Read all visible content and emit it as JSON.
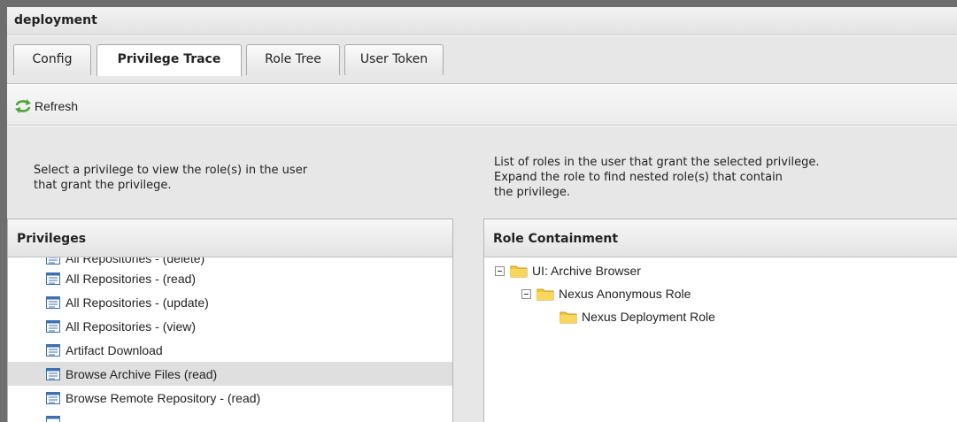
{
  "window": {
    "title": "deployment"
  },
  "tabs": [
    {
      "label": "Config"
    },
    {
      "label": "Privilege Trace"
    },
    {
      "label": "Role Tree"
    },
    {
      "label": "User Token"
    }
  ],
  "toolbar": {
    "refresh_label": "Refresh"
  },
  "descriptions": {
    "left_line1": "Select a privilege to view the role(s) in the user",
    "left_line2": "that grant the privilege.",
    "right_line1": "List of roles in the user that grant the selected privilege.",
    "right_line2": "Expand the role to find nested role(s) that contain",
    "right_line3": "the privilege."
  },
  "privileges": {
    "header": "Privileges",
    "items": [
      {
        "label": "All Repositories - (delete)"
      },
      {
        "label": "All Repositories - (read)"
      },
      {
        "label": "All Repositories - (update)"
      },
      {
        "label": "All Repositories - (view)"
      },
      {
        "label": "Artifact Download"
      },
      {
        "label": "Browse Archive Files (read)"
      },
      {
        "label": "Browse Remote Repository - (read)"
      }
    ],
    "selected": "Browse Archive Files (read)"
  },
  "role_containment": {
    "header": "Role Containment",
    "nodes": [
      {
        "label": "UI: Archive Browser"
      },
      {
        "label": "Nexus Anonymous Role"
      },
      {
        "label": "Nexus Deployment Role"
      }
    ]
  },
  "colors": {
    "folder": "#f4c93a",
    "selected_row": "#dfdfdf",
    "refresh_icon": "#4aa53a",
    "doc_icon": "#3e6fb0"
  }
}
